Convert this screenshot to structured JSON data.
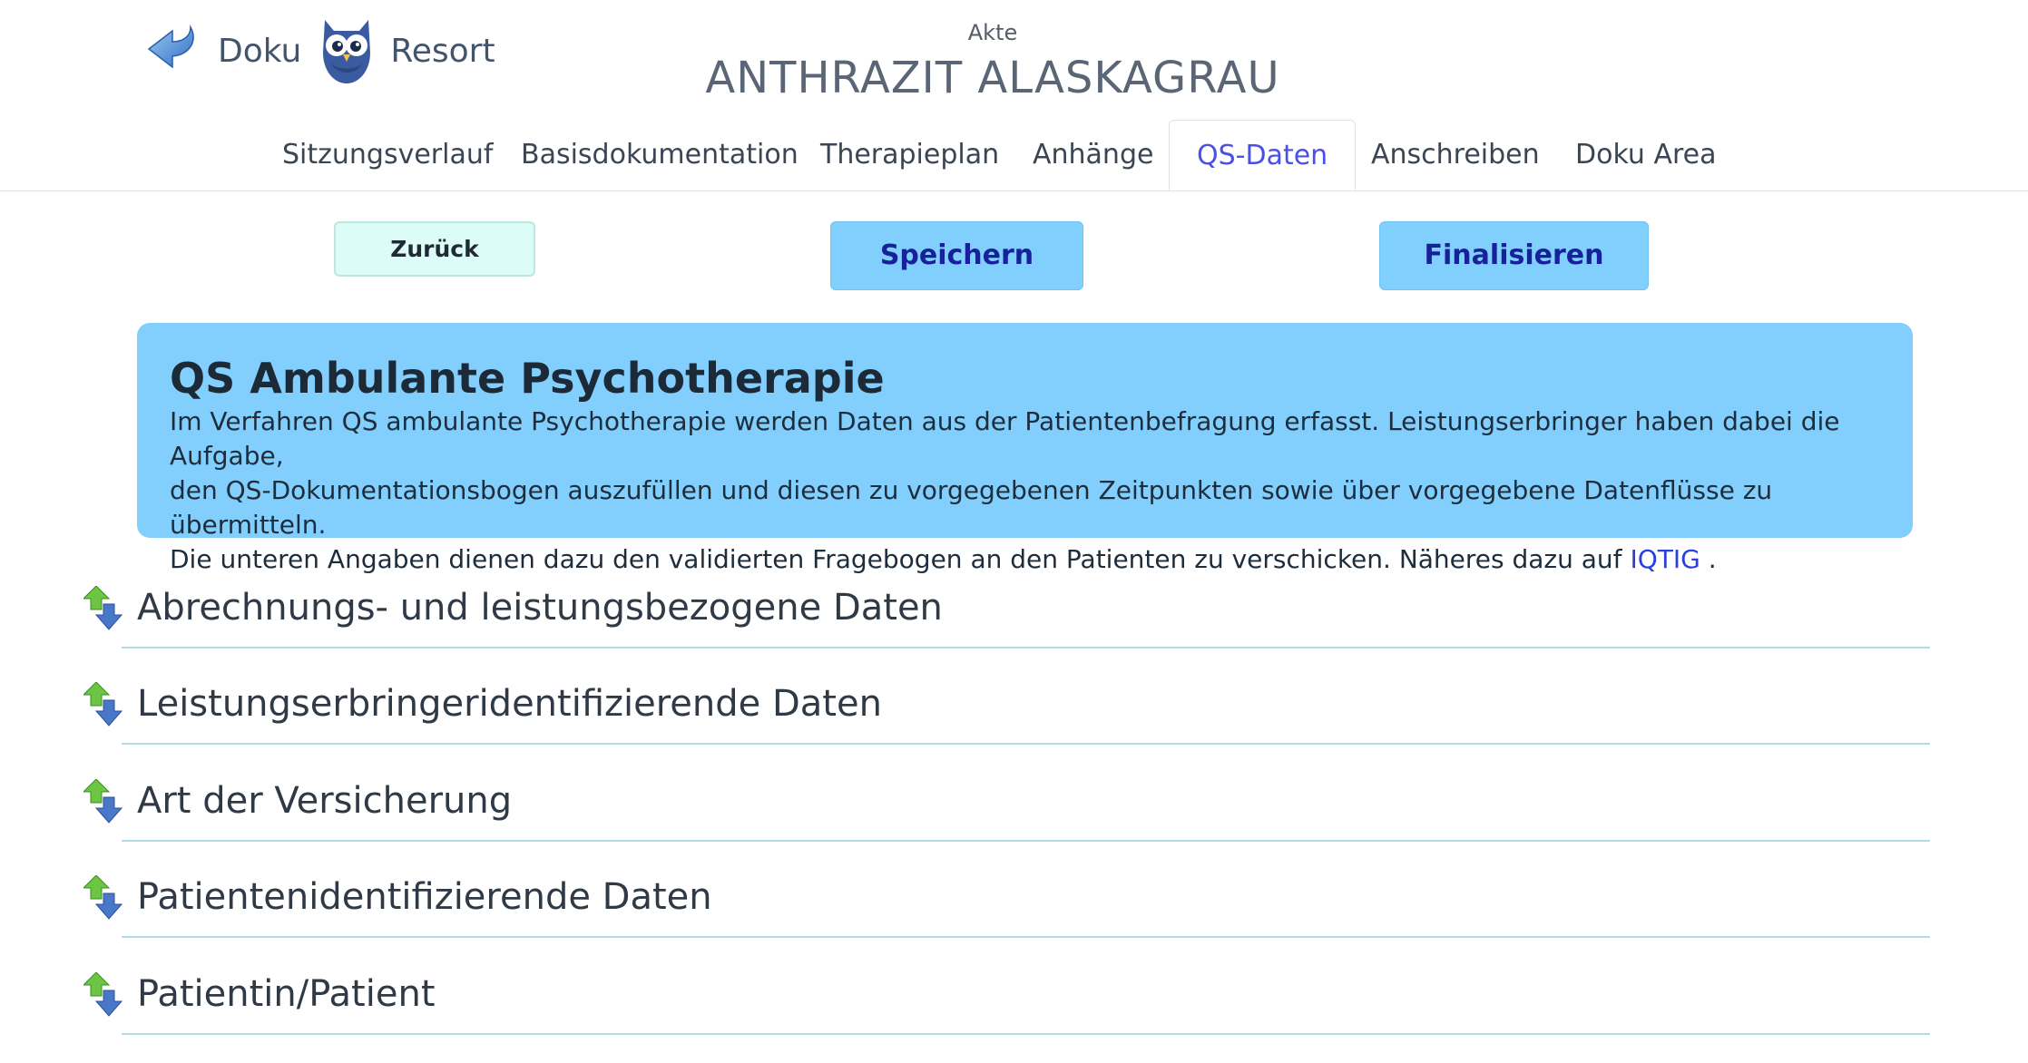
{
  "header": {
    "logo_left": "Doku",
    "logo_right": "Resort",
    "akte_label": "Akte",
    "patient_name": "ANTHRAZIT ALASKAGRAU"
  },
  "tabs": [
    {
      "label": "Sitzungsverlauf",
      "active": false
    },
    {
      "label": "Basisdokumentation",
      "active": false
    },
    {
      "label": "Therapieplan",
      "active": false
    },
    {
      "label": "Anhänge",
      "active": false
    },
    {
      "label": "QS-Daten",
      "active": true
    },
    {
      "label": "Anschreiben",
      "active": false
    },
    {
      "label": "Doku Area",
      "active": false
    }
  ],
  "actions": {
    "back_label": "Zurück",
    "save_label": "Speichern",
    "finalize_label": "Finalisieren"
  },
  "info": {
    "title": "QS Ambulante Psychotherapie",
    "line1": "Im Verfahren QS ambulante Psychotherapie werden Daten aus der Patientenbefragung erfasst. Leistungserbringer haben dabei die Aufgabe,",
    "line2": "den QS-Dokumentationsbogen auszufüllen und diesen zu vorgegebenen Zeitpunkten sowie über vorgegebene Datenflüsse zu übermitteln.",
    "line3_prefix": "Die unteren Angaben dienen dazu den validierten Fragebogen an den Patienten zu verschicken. Näheres dazu auf ",
    "link_label": "IQTIG",
    "line3_suffix": " ."
  },
  "sections": [
    {
      "label": "Abrechnungs- und leistungsbezogene Daten",
      "icon": "expand-arrows-icon"
    },
    {
      "label": "Leistungserbringeridentifizierende Daten",
      "icon": "expand-arrows-icon"
    },
    {
      "label": "Art der Versicherung",
      "icon": "expand-arrows-icon"
    },
    {
      "label": "Patientenidentifizierende Daten",
      "icon": "expand-arrows-icon"
    },
    {
      "label": "Patientin/Patient",
      "icon": "expand-arrows-icon"
    }
  ],
  "colors": {
    "tab_active": "#4b50e6",
    "button_primary": "#80cffc",
    "button_back": "#dcfcf7",
    "info_box": "#82cffd",
    "link": "#2a3fe0",
    "section_divider": "#b3d9e6"
  }
}
